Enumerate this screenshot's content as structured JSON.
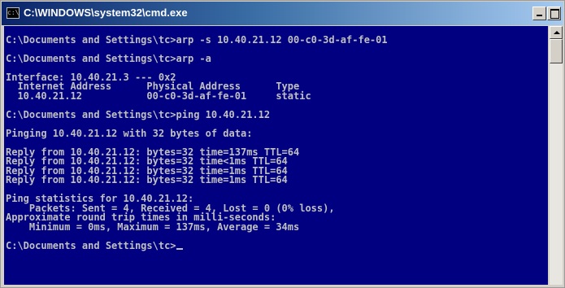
{
  "window": {
    "title": "C:\\WINDOWS\\system32\\cmd.exe",
    "icon": "cmd-console-icon",
    "icon_glyph": "c:\\"
  },
  "console": {
    "lines": [
      "",
      "C:\\Documents and Settings\\tc>arp -s 10.40.21.12 00-c0-3d-af-fe-01",
      "",
      "C:\\Documents and Settings\\tc>arp -a",
      "",
      "Interface: 10.40.21.3 --- 0x2",
      "  Internet Address      Physical Address      Type",
      "  10.40.21.12           00-c0-3d-af-fe-01     static",
      "",
      "C:\\Documents and Settings\\tc>ping 10.40.21.12",
      "",
      "Pinging 10.40.21.12 with 32 bytes of data:",
      "",
      "Reply from 10.40.21.12: bytes=32 time=137ms TTL=64",
      "Reply from 10.40.21.12: bytes=32 time<1ms TTL=64",
      "Reply from 10.40.21.12: bytes=32 time=1ms TTL=64",
      "Reply from 10.40.21.12: bytes=32 time=1ms TTL=64",
      "",
      "Ping statistics for 10.40.21.12:",
      "    Packets: Sent = 4, Received = 4, Lost = 0 (0% loss),",
      "Approximate round trip times in milli-seconds:",
      "    Minimum = 0ms, Maximum = 137ms, Average = 34ms",
      "",
      "C:\\Documents and Settings\\tc>"
    ],
    "background": "#000080",
    "foreground": "#c0c0c0"
  }
}
